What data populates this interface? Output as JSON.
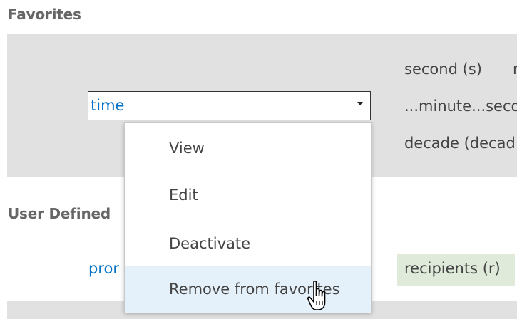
{
  "favorites": {
    "heading": "Favorites",
    "select_value": "time",
    "units": [
      "second (s)",
      "...minute...seco",
      "decade (decad"
    ],
    "cut_text": "m"
  },
  "user_defined": {
    "heading": "User Defined",
    "link_text": "pror",
    "recipients_label": "recipients (r)"
  },
  "dropdown": {
    "items": [
      "View",
      "Edit",
      "Deactivate",
      "Remove from favorites"
    ],
    "hovered_index": 3
  },
  "colors": {
    "panel": "#e1e1e1",
    "link": "#0072c6",
    "hover": "#e5f1fa",
    "chip": "#dfeadb"
  },
  "icons": {
    "cursor": "hand-pointer-icon",
    "select_arrow": "triangle-down-icon"
  }
}
